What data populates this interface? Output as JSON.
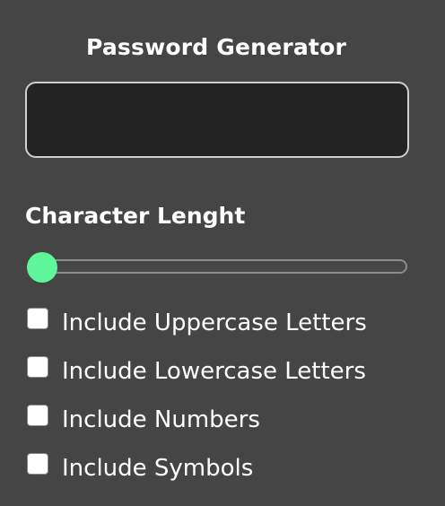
{
  "app": {
    "title": "Password Generator"
  },
  "password": {
    "value": ""
  },
  "length": {
    "label": "Character Lenght",
    "slider_fraction": 0.0
  },
  "options": [
    {
      "label": "Include Uppercase Letters",
      "checked": false
    },
    {
      "label": "Include Lowercase Letters",
      "checked": false
    },
    {
      "label": "Include Numbers",
      "checked": false
    },
    {
      "label": "Include Symbols",
      "checked": false
    }
  ],
  "colors": {
    "background": "#454545",
    "display_background": "#232323",
    "accent": "#5ff59a",
    "text": "#ffffff"
  }
}
